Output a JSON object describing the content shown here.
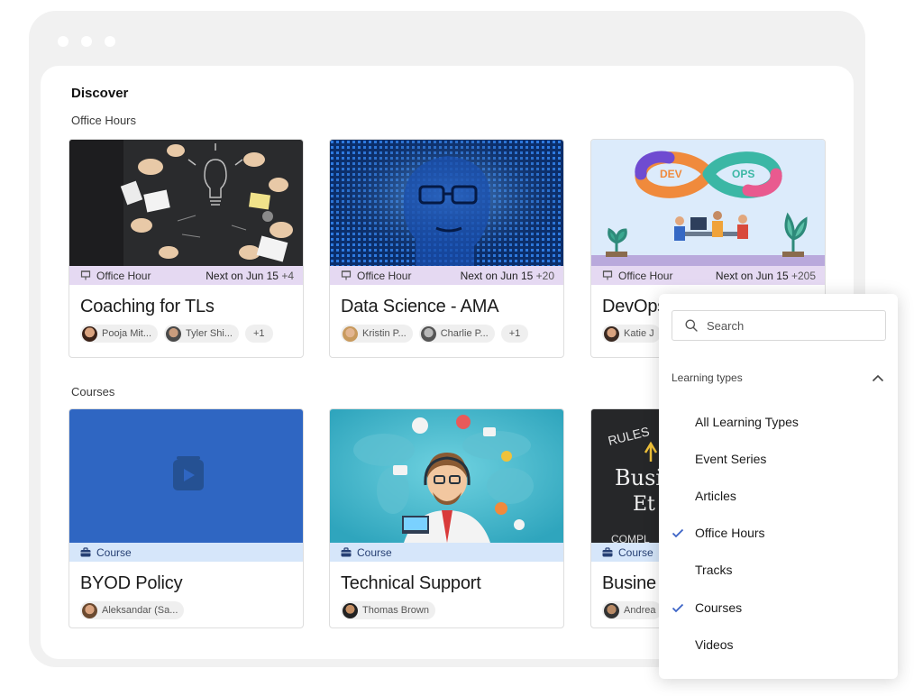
{
  "page": {
    "title": "Discover"
  },
  "sections": {
    "office_hours": "Office Hours",
    "courses": "Courses"
  },
  "office_hour_cards": [
    {
      "type_label": "Office Hour",
      "next_label": "Next on Jun 15",
      "extra": "+4",
      "title": "Coaching for TLs",
      "chips": [
        "Pooja Mit...",
        "Tyler Shi...",
        "+1"
      ]
    },
    {
      "type_label": "Office Hour",
      "next_label": "Next on Jun 15",
      "extra": "+20",
      "title": "Data Science - AMA",
      "chips": [
        "Kristin P...",
        "Charlie P...",
        "+1"
      ]
    },
    {
      "type_label": "Office Hour",
      "next_label": "Next on Jun 15",
      "extra": "+205",
      "title": "DevOps",
      "chips": [
        "Katie J"
      ],
      "image_text": [
        "DEV",
        "OPS"
      ]
    }
  ],
  "course_cards": [
    {
      "type_label": "Course",
      "title": "BYOD Policy",
      "chips": [
        "Aleksandar (Sa..."
      ]
    },
    {
      "type_label": "Course",
      "title": "Technical Support",
      "chips": [
        "Thomas Brown"
      ]
    },
    {
      "type_label": "Course",
      "title": "Busine",
      "chips": [
        "Andrea"
      ],
      "image_text": [
        "RULES",
        "Busi",
        "Et",
        "COMPL"
      ]
    }
  ],
  "filter": {
    "search_placeholder": "Search",
    "section_label": "Learning types",
    "options": [
      {
        "label": "All Learning Types",
        "checked": false
      },
      {
        "label": "Event Series",
        "checked": false
      },
      {
        "label": "Articles",
        "checked": false
      },
      {
        "label": "Office Hours",
        "checked": true
      },
      {
        "label": "Tracks",
        "checked": false
      },
      {
        "label": "Courses",
        "checked": true
      },
      {
        "label": "Videos",
        "checked": false
      }
    ]
  },
  "colors": {
    "office_hour_strip": "#e5d9f2",
    "course_strip": "#d6e6fa",
    "check": "#3b63c6",
    "course_placeholder": "#2f66c2"
  },
  "icons": {
    "office_hour": "presentation-board-icon",
    "course": "briefcase-icon",
    "search": "magnifier-icon",
    "collapse": "chevron-up-icon",
    "check": "checkmark-icon"
  }
}
